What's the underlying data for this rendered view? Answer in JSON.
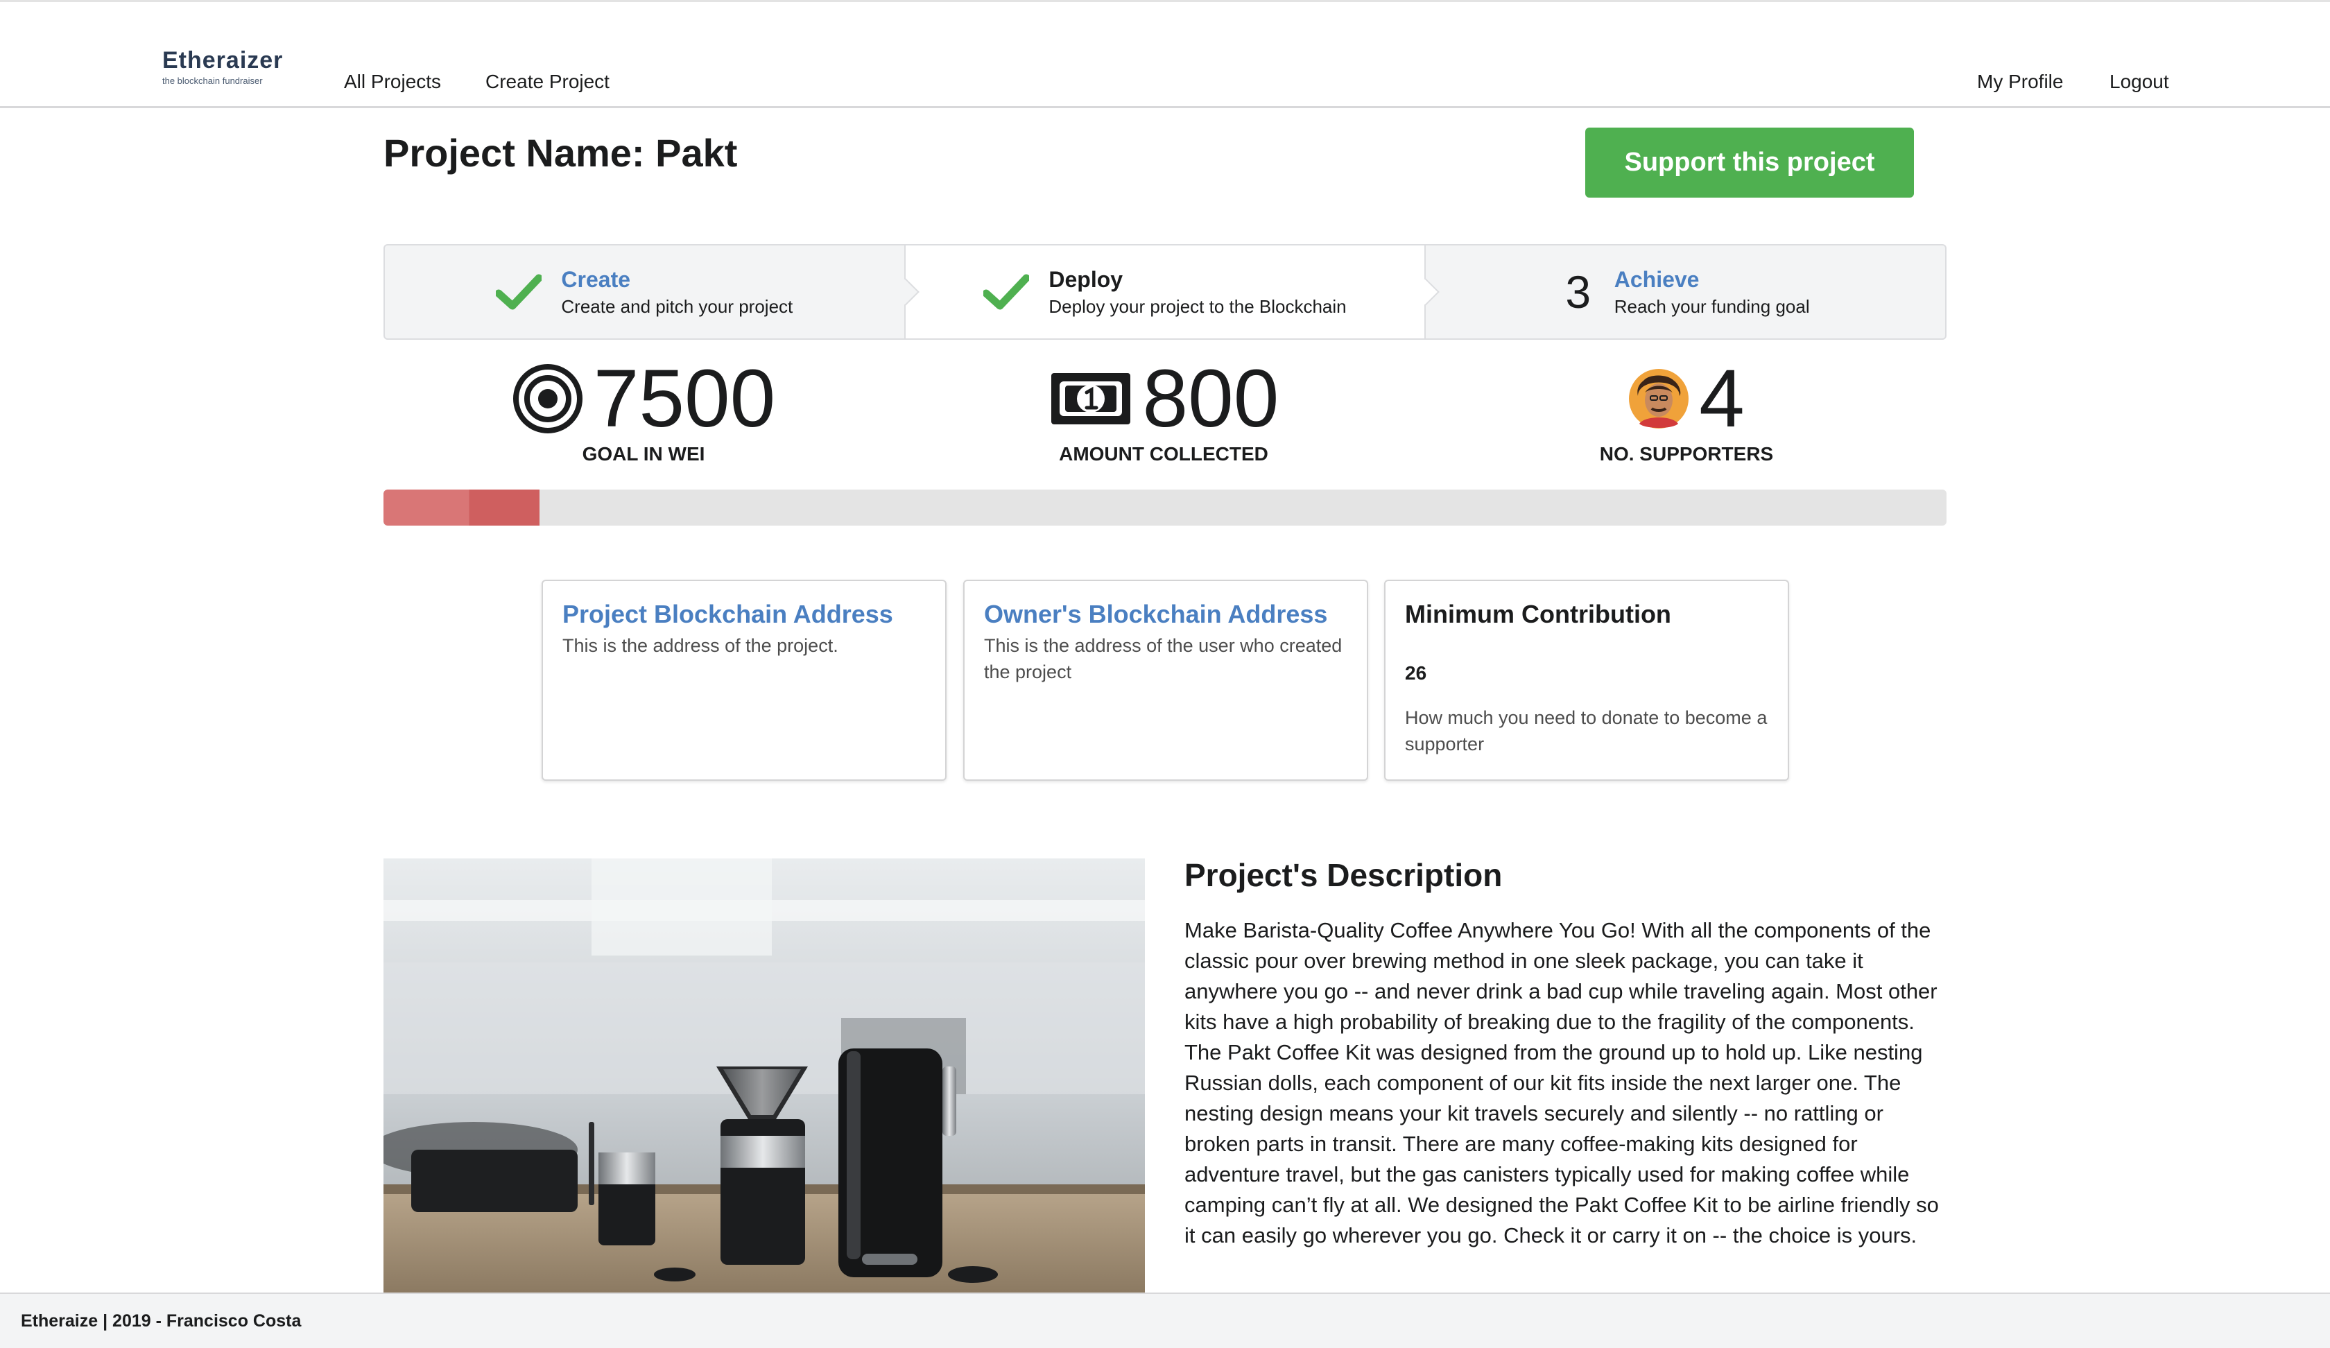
{
  "app": {
    "logo_title": "Etheraizer",
    "logo_subtitle": "the blockchain fundraiser"
  },
  "nav": {
    "left": [
      "All Projects",
      "Create Project"
    ],
    "right": [
      "My Profile",
      "Logout"
    ]
  },
  "project": {
    "title": "Project Name: Pakt",
    "support_button": "Support this project"
  },
  "steps": [
    {
      "title": "Create",
      "description": "Create and pitch your project",
      "state": "completed",
      "marker": "check"
    },
    {
      "title": "Deploy",
      "description": "Deploy your project to the Blockchain",
      "state": "active",
      "marker": "check"
    },
    {
      "title": "Achieve",
      "description": "Reach your funding goal",
      "state": "pending",
      "marker": "3"
    }
  ],
  "stats": {
    "goal": {
      "value": "7500",
      "label": "GOAL IN WEI",
      "icon": "target-icon"
    },
    "collected": {
      "value": "800",
      "label": "AMOUNT COLLECTED",
      "icon": "money-bill-icon"
    },
    "supporters": {
      "value": "4",
      "label": "NO. SUPPORTERS",
      "icon": "avatar"
    }
  },
  "progress": {
    "fraction": 0.1
  },
  "cards": {
    "project_address": {
      "title": "Project Blockchain Address",
      "description": "This is the address of the project."
    },
    "owner_address": {
      "title": "Owner's Blockchain Address",
      "description": "This is the address of the user who created the project"
    },
    "min_contribution": {
      "title": "Minimum Contribution",
      "value": "26",
      "note": "How much you need to donate to become a supporter"
    }
  },
  "description": {
    "heading": "Project's Description",
    "body": "Make Barista-Quality Coffee Anywhere You Go! With all the components of the classic pour over brewing method in one sleek package, you can take it anywhere you go -- and never drink a bad cup while traveling again. Most other kits have a high probability of breaking due to the fragility of the components. The Pakt Coffee Kit was designed from the ground up to hold up. Like nesting Russian dolls, each component of our kit fits inside the next larger one. The nesting design means your kit travels securely and silently -- no rattling or broken parts in transit. There are many coffee-making kits designed for adventure travel, but the gas canisters typically used for making coffee while camping can’t fly at all. We designed the Pakt Coffee Kit to be airline friendly so it can easily go wherever you go. Check it or carry it on -- the choice is yours."
  },
  "footer": {
    "text": "Etheraize | 2019 - Francisco Costa"
  },
  "colors": {
    "accent_blue": "#4a7fc1",
    "success_green": "#4fb050",
    "progress_red": "#d97676"
  }
}
